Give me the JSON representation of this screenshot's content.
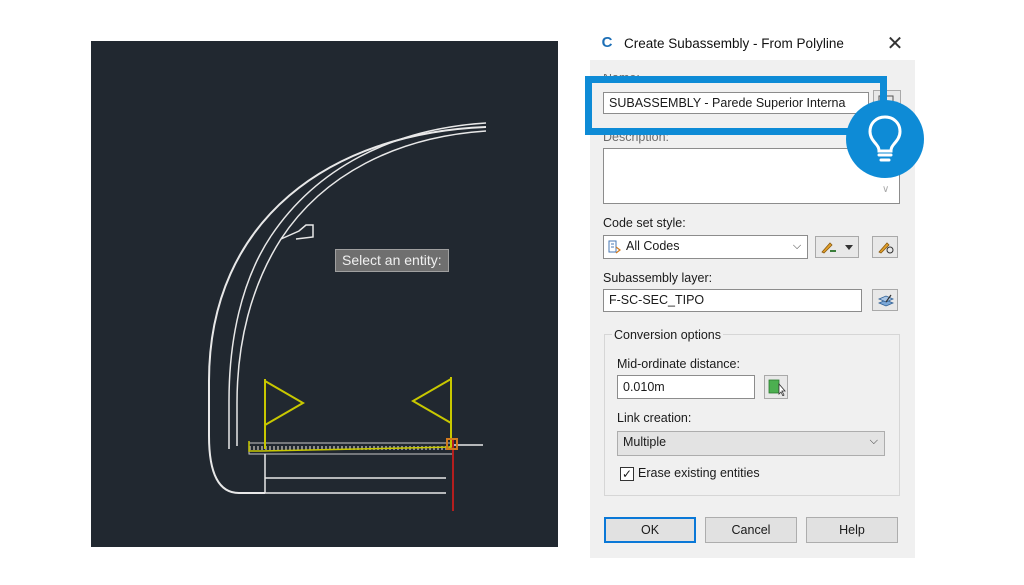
{
  "cad": {
    "prompt": "Select an entity:"
  },
  "dialog": {
    "title": "Create Subassembly - From Polyline",
    "app_icon_glyph": "C",
    "close_glyph": "✕",
    "name_label": "Name:",
    "name_value": "SUBASSEMBLY - Parede Superior Interna",
    "description_label": "Description:",
    "description_value": "",
    "code_set_label": "Code set style:",
    "code_set_value": "All Codes",
    "layer_label": "Subassembly layer:",
    "layer_value": "F-SC-SEC_TIPO",
    "conversion_group_label": "Conversion options",
    "midordinate_label": "Mid-ordinate distance:",
    "midordinate_value": "0.010m",
    "link_creation_label": "Link creation:",
    "link_creation_value": "Multiple",
    "erase_label": "Erase existing entities",
    "erase_checked": true,
    "check_glyph": "✓",
    "ok_label": "OK",
    "cancel_label": "Cancel",
    "help_label": "Help",
    "dropdown_glyph": "⌵"
  },
  "overlay": {
    "highlight_color": "#0e8bd6",
    "tip_icon": "lightbulb-icon"
  },
  "colors": {
    "cad_background": "#212830",
    "dialog_background": "#f0f0f0",
    "accent": "#0e8bd6",
    "flag_color": "#c8c800",
    "axis_red": "#b41e1e"
  }
}
